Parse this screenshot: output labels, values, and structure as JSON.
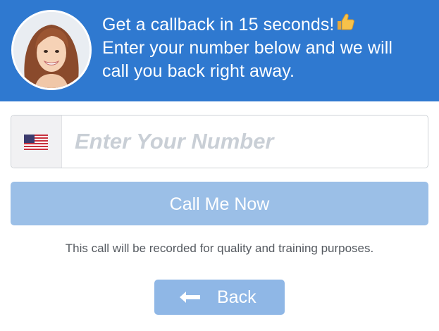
{
  "header": {
    "line1": "Get a callback in 15 seconds!",
    "line2": "Enter your number below and we will",
    "line3": "call you back right away.",
    "thumb_icon": "thumbs-up-icon",
    "background_color": "#2f79d0"
  },
  "avatar": {
    "icon": "agent-avatar"
  },
  "phone": {
    "flag_icon": "us-flag-icon",
    "placeholder": "Enter Your Number",
    "value": ""
  },
  "call_button": {
    "label": "Call Me Now",
    "color": "#9bbfe7"
  },
  "disclaimer": "This call will be recorded for quality and training purposes.",
  "back_button": {
    "label": "Back",
    "icon": "left-arrow-icon",
    "color": "#8fb7e6"
  }
}
